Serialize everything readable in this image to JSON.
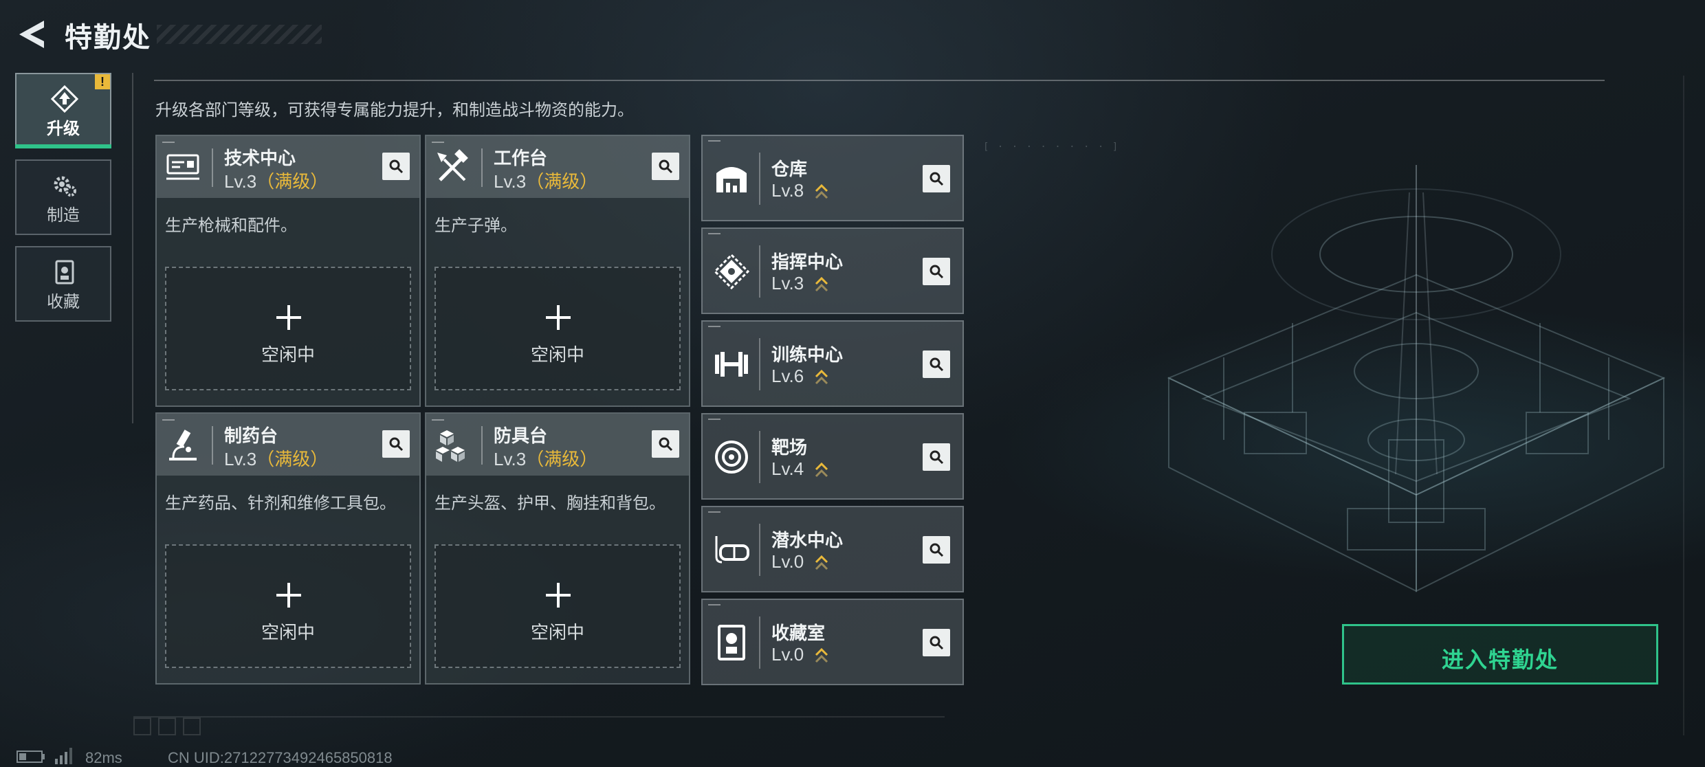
{
  "header": {
    "title": "特勤处",
    "back_icon": "back-arrow-icon"
  },
  "nav": {
    "items": [
      {
        "label": "升级",
        "icon": "upgrade-icon",
        "active": true,
        "alert": "!"
      },
      {
        "label": "制造",
        "icon": "gear-icon",
        "active": false
      },
      {
        "label": "收藏",
        "icon": "collection-icon",
        "active": false
      }
    ]
  },
  "description": "升级各部门等级，可获得专属能力提升，和制造战斗物资的能力。",
  "production": [
    {
      "name": "技术中心",
      "level": "Lv.3",
      "max": "（满级）",
      "desc": "生产枪械和配件。",
      "slot": "空闲中",
      "icon": "tech-center-icon"
    },
    {
      "name": "工作台",
      "level": "Lv.3",
      "max": "（满级）",
      "desc": "生产子弹。",
      "slot": "空闲中",
      "icon": "workbench-icon"
    },
    {
      "name": "制药台",
      "level": "Lv.3",
      "max": "（满级）",
      "desc": "生产药品、针剂和维修工具包。",
      "slot": "空闲中",
      "icon": "microscope-icon"
    },
    {
      "name": "防具台",
      "level": "Lv.3",
      "max": "（满级）",
      "desc": "生产头盔、护甲、胸挂和背包。",
      "slot": "空闲中",
      "icon": "armor-bench-icon"
    }
  ],
  "facilities": [
    {
      "name": "仓库",
      "level": "Lv.8",
      "icon": "warehouse-icon"
    },
    {
      "name": "指挥中心",
      "level": "Lv.3",
      "icon": "command-center-icon"
    },
    {
      "name": "训练中心",
      "level": "Lv.6",
      "icon": "dumbbell-icon"
    },
    {
      "name": "靶场",
      "level": "Lv.4",
      "icon": "target-icon"
    },
    {
      "name": "潜水中心",
      "level": "Lv.0",
      "icon": "diving-mask-icon"
    },
    {
      "name": "收藏室",
      "level": "Lv.0",
      "icon": "collection-room-icon"
    }
  ],
  "enter_button": "进入特勤处",
  "status": {
    "ping": "82ms",
    "uid": "CN UID:27122773492465850818"
  },
  "colors": {
    "accent_green": "#2fc38a",
    "max_gold": "#e9b93a",
    "alert_yellow": "#e9b93a"
  }
}
